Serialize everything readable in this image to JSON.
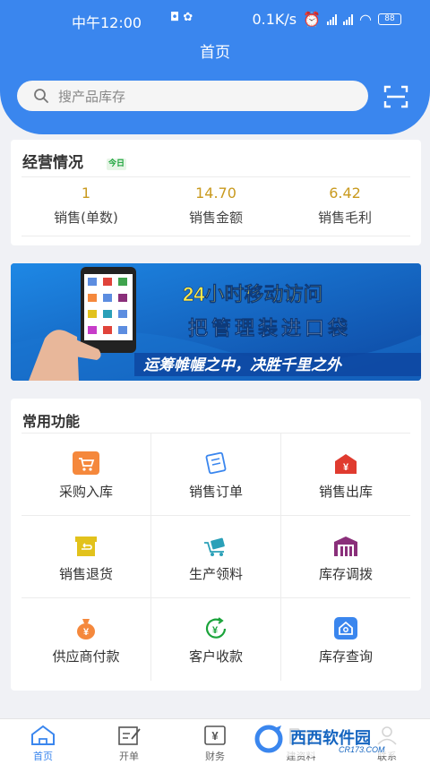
{
  "status_bar": {
    "time": "中午12:00",
    "net_speed": "0.1K/s",
    "battery": "88"
  },
  "header": {
    "title": "首页",
    "search_placeholder": "搜产品库存"
  },
  "business": {
    "title": "经营情况",
    "badge": "今日",
    "stats": [
      {
        "value": "1",
        "label": "销售(单数)"
      },
      {
        "value": "14.70",
        "label": "销售金额"
      },
      {
        "value": "6.42",
        "label": "销售毛利"
      }
    ]
  },
  "banner": {
    "headline": "24小时移动访问",
    "subline": "把管理装进口袋",
    "slogan": "运筹帷幄之中，决胜千里之外"
  },
  "functions": {
    "title": "常用功能",
    "items": [
      {
        "label": "采购入库",
        "icon": "cart-icon",
        "color": "#f5883c"
      },
      {
        "label": "销售订单",
        "icon": "order-icon",
        "color": "#3a86ee"
      },
      {
        "label": "销售出库",
        "icon": "outbound-icon",
        "color": "#e03b2f"
      },
      {
        "label": "销售退货",
        "icon": "return-icon",
        "color": "#e2c21c"
      },
      {
        "label": "生产领料",
        "icon": "cart-truck-icon",
        "color": "#2aa0b8"
      },
      {
        "label": "库存调拨",
        "icon": "warehouse-icon",
        "color": "#8a2f7a"
      },
      {
        "label": "供应商付款",
        "icon": "money-bag-icon",
        "color": "#f5883c"
      },
      {
        "label": "客户收款",
        "icon": "receive-money-icon",
        "color": "#1aa33a"
      },
      {
        "label": "库存查询",
        "icon": "stock-query-icon",
        "color": "#3a86ee"
      }
    ]
  },
  "tabs": [
    {
      "label": "首页",
      "icon": "home-icon",
      "active": true
    },
    {
      "label": "开单",
      "icon": "edit-icon",
      "active": false
    },
    {
      "label": "财务",
      "icon": "yen-icon",
      "active": false
    },
    {
      "label": "建资料",
      "icon": "folder-icon",
      "active": false
    },
    {
      "label": "联系",
      "icon": "contact-icon",
      "active": false
    }
  ],
  "watermark": {
    "name": "西西软件园",
    "url": "CR173.COM"
  },
  "colors": {
    "primary": "#3a86ee",
    "stat_value": "#c99a1f"
  }
}
